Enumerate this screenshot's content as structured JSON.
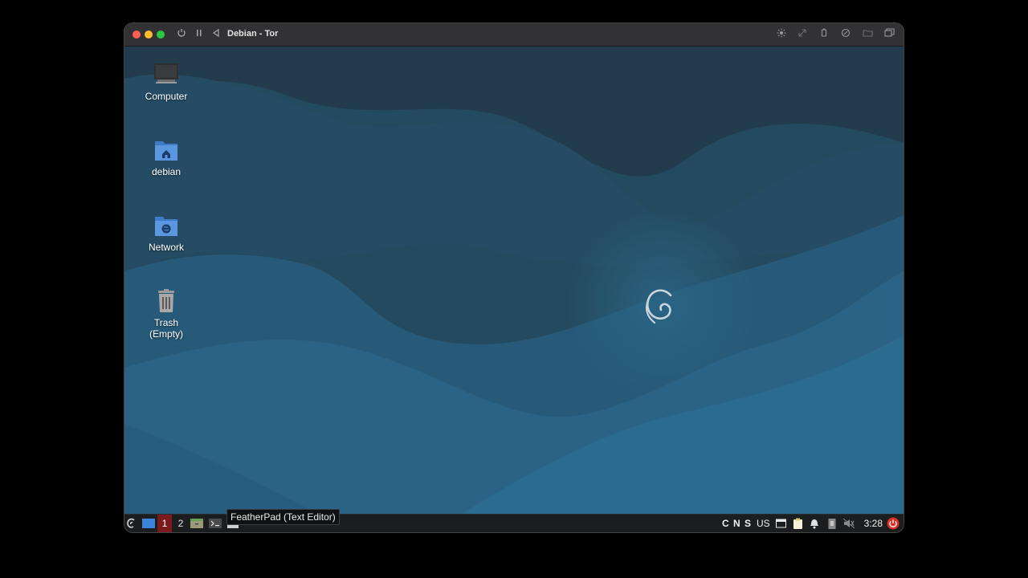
{
  "vm": {
    "title": "Debian - Tor"
  },
  "desktop": {
    "icons": [
      {
        "label": "Computer",
        "icon": "computer-icon"
      },
      {
        "label": "debian",
        "icon": "home-folder-icon"
      },
      {
        "label": "Network",
        "icon": "network-folder-icon"
      },
      {
        "label": "Trash\n(Empty)",
        "icon": "trash-icon"
      }
    ]
  },
  "taskbar": {
    "workspaces": [
      "1",
      "2"
    ],
    "active_workspace": "1",
    "tooltip": "FeatherPad (Text Editor)",
    "tray_letters": [
      "C",
      "N",
      "S"
    ],
    "keyboard_layout": "US",
    "clock": "3:28"
  },
  "colors": {
    "accent_workspace": "#7b1a1c",
    "power": "#d93025",
    "desktop_bg": "#1f4a63"
  }
}
